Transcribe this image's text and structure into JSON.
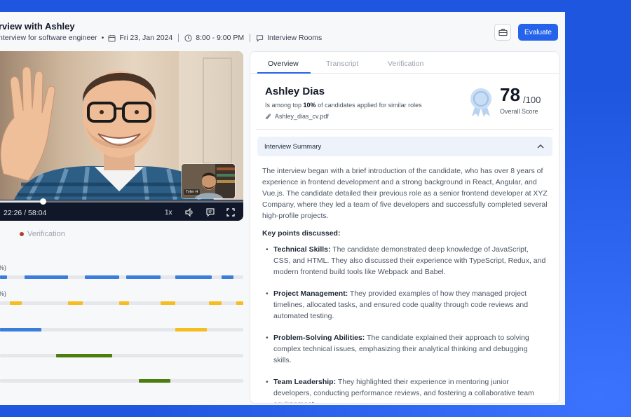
{
  "header": {
    "title": "rview with Ashley",
    "role": "nterview for software engineer",
    "date": "Fri 23, Jan 2024",
    "time": "8:00 - 9:00 PM",
    "location": "Interview Rooms",
    "evaluate_label": "Evaluate"
  },
  "video": {
    "pip_name": "Tyler H",
    "current_time": "22:26",
    "total_time": "58:04",
    "time_display": "22:26 / 58:04",
    "speed": "1x",
    "progress": 0.177
  },
  "timeline": {
    "legend_label": "Verification",
    "rows": [
      {
        "label": "%)",
        "color": "#3b7ddd",
        "segments": [
          [
            0,
            0.03
          ],
          [
            0.1,
            0.28
          ],
          [
            0.35,
            0.49
          ],
          [
            0.52,
            0.66
          ],
          [
            0.72,
            0.87
          ],
          [
            0.91,
            0.96
          ]
        ]
      },
      {
        "label": "%)",
        "color": "#f5bd1f",
        "segments": [
          [
            0.04,
            0.09
          ],
          [
            0.28,
            0.34
          ],
          [
            0.49,
            0.53
          ],
          [
            0.66,
            0.72
          ],
          [
            0.86,
            0.91
          ],
          [
            0.97,
            1.0
          ]
        ]
      },
      {
        "label": "",
        "color": "#3b7ddd",
        "segments": [
          [
            0,
            0.17
          ]
        ],
        "extra_color": "#f5bd1f",
        "extra": [
          [
            0.72,
            0.85
          ]
        ]
      },
      {
        "label": "",
        "color": "#4d7c0f",
        "segments": [
          [
            0.23,
            0.46
          ]
        ]
      },
      {
        "label": "",
        "color": "#4d7c0f",
        "segments": [
          [
            0.57,
            0.7
          ]
        ]
      }
    ]
  },
  "panel": {
    "tabs": [
      {
        "label": "Overview",
        "active": true
      },
      {
        "label": "Transcript",
        "active": false
      },
      {
        "label": "Verification",
        "active": false
      }
    ],
    "candidate": {
      "name": "Ashley Dias",
      "sub_prefix": "Is among top ",
      "sub_bold": "10%",
      "sub_suffix": " of candidates applied for similar roles",
      "file": "Ashley_dias_cv.pdf"
    },
    "score": {
      "value": "78",
      "max": "/100",
      "label": "Overall Score"
    },
    "summary": {
      "title": "Interview Summary",
      "intro": "The interview began with a brief introduction of the candidate, who has over 8 years of experience in frontend development and a strong background in React, Angular, and Vue.js. The candidate detailed their previous role as a senior frontend developer at XYZ Company, where they led a team of five developers and successfully completed several high-profile projects.",
      "key_points_title": "Key points discussed:",
      "points": [
        {
          "title": "Technical Skills:",
          "text": " The candidate demonstrated deep knowledge of JavaScript, CSS, and HTML. They also discussed their experience with TypeScript, Redux, and modern frontend build tools like Webpack and Babel."
        },
        {
          "title": "Project Management:",
          "text": " They provided examples of how they managed project timelines, allocated tasks, and ensured code quality through code reviews and automated testing."
        },
        {
          "title": "Problem-Solving Abilities:",
          "text": " The candidate explained their approach to solving complex technical issues, emphasizing their analytical thinking and debugging skills."
        },
        {
          "title": "Team Leadership:",
          "text": " They highlighted their experience in mentoring junior developers, conducting performance reviews, and fostering a collaborative team environment."
        }
      ]
    }
  },
  "colors": {
    "accent": "#2563eb",
    "bg": "#1f56e0"
  }
}
